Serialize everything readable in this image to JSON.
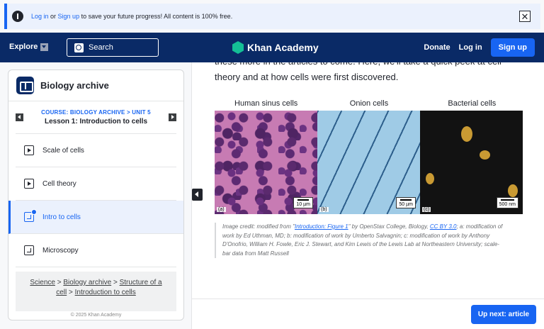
{
  "banner": {
    "login_link": "Log in",
    "or_text": " or ",
    "signup_link": "Sign up",
    "message": " to save your future progress! All content is 100% free.",
    "close_symbol": "✕"
  },
  "nav": {
    "explore_label": "Explore",
    "search_label": "Search",
    "brand_name": "Khan Academy",
    "donate_label": "Donate",
    "login_label": "Log in",
    "signup_label": "Sign up"
  },
  "sidebar": {
    "title": "Biology archive",
    "course_crumb": "COURSE: BIOLOGY ARCHIVE > UNIT 5",
    "lesson_name": "Lesson 1: Introduction to cells",
    "items": [
      {
        "label": "Scale of cells",
        "icon": "video-icon"
      },
      {
        "label": "Cell theory",
        "icon": "video-icon"
      },
      {
        "label": "Intro to cells",
        "icon": "article-icon"
      },
      {
        "label": "Microscopy",
        "icon": "article-icon"
      }
    ],
    "breadcrumbs": {
      "science": "Science",
      "biology_archive": "Biology archive",
      "structure": "Structure of a cell",
      "intro": "Introduction to cells",
      "sep": " > "
    },
    "copyright": "© 2025 Khan Academy"
  },
  "content": {
    "intro_text": "these more in the articles to come. Here, we'll take a quick peek at cell theory and at how cells were first discovered.",
    "captions": [
      "Human sinus cells",
      "Onion cells",
      "Bacterial cells"
    ],
    "image_labels": [
      "(a)",
      "(b)",
      "(c)"
    ],
    "scale_bars": [
      "10 µm",
      "50 µm",
      "500 nm"
    ],
    "credit": {
      "prefix": "Image credit: modified from \"",
      "link1": "Introduction: Figure 1",
      "middle": "\" by OpenStax College, Biology, ",
      "link2": "CC BY 3.0",
      "suffix": "; a: modification of work by Ed Uthman, MD; b: modification of work by Umberto Salvagnin; c: modification of work by Anthony D'Onofrio, William H. Fowle, Eric J. Stewart, and Kim Lewis of the Lewis Lab at Northeastern University; scale-bar data from Matt Russell"
    }
  },
  "footer": {
    "up_next_label": "Up next: article"
  }
}
